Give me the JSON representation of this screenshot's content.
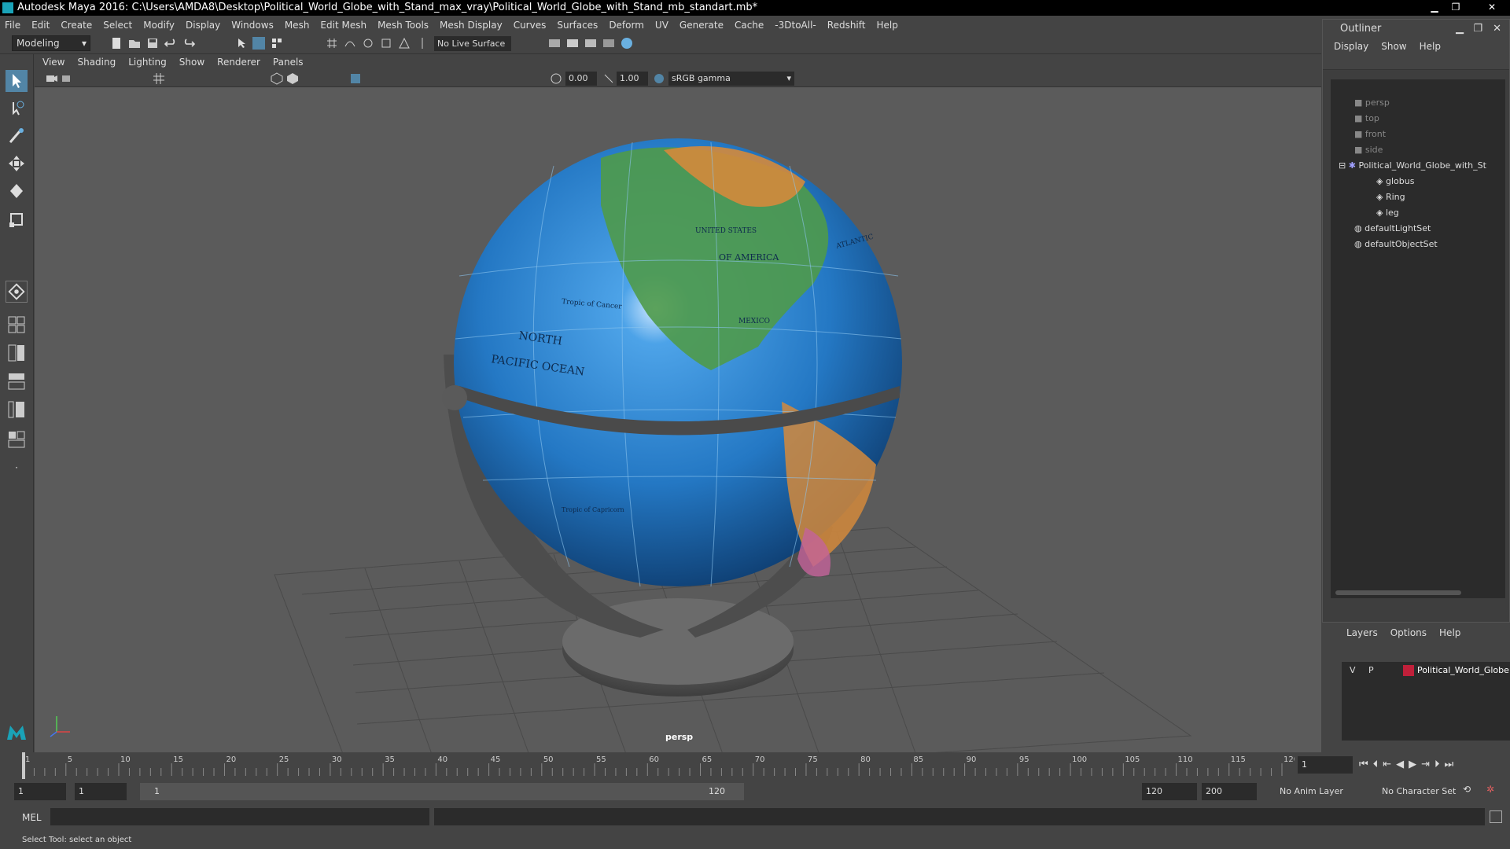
{
  "window": {
    "title": "Autodesk Maya 2016: C:\\Users\\AMDA8\\Desktop\\Political_World_Globe_with_Stand_max_vray\\Political_World_Globe_with_Stand_mb_standart.mb*"
  },
  "menubar": [
    "File",
    "Edit",
    "Create",
    "Select",
    "Modify",
    "Display",
    "Windows",
    "Mesh",
    "Edit Mesh",
    "Mesh Tools",
    "Mesh Display",
    "Curves",
    "Surfaces",
    "Deform",
    "UV",
    "Generate",
    "Cache",
    "-3DtoAll-",
    "Redshift",
    "Help"
  ],
  "toolbar": {
    "mode": "Modeling",
    "live_surface": "No Live Surface"
  },
  "viewport": {
    "menu": [
      "View",
      "Shading",
      "Lighting",
      "Show",
      "Renderer",
      "Panels"
    ],
    "exposure": "0.00",
    "gamma": "1.00",
    "color_space": "sRGB gamma",
    "camera_label": "persp",
    "globe_labels": [
      "UNITED STATES",
      "OF AMERICA",
      "NORTH",
      "PACIFIC OCEAN",
      "Tropic of Cancer",
      "MEXICO",
      "ATLANTIC",
      "Tropic of Capricorn"
    ]
  },
  "outliner": {
    "title": "Outliner",
    "menu": [
      "Display",
      "Show",
      "Help"
    ],
    "items": [
      {
        "label": "persp",
        "type": "camera",
        "dim": true
      },
      {
        "label": "top",
        "type": "camera",
        "dim": true
      },
      {
        "label": "front",
        "type": "camera",
        "dim": true
      },
      {
        "label": "side",
        "type": "camera",
        "dim": true
      },
      {
        "label": "Political_World_Globe_with_St",
        "type": "group",
        "dim": false
      },
      {
        "label": "globus",
        "type": "mesh",
        "dim": false
      },
      {
        "label": "Ring",
        "type": "mesh",
        "dim": false
      },
      {
        "label": "leg",
        "type": "mesh",
        "dim": false
      },
      {
        "label": "defaultLightSet",
        "type": "set",
        "dim": false
      },
      {
        "label": "defaultObjectSet",
        "type": "set",
        "dim": false
      }
    ]
  },
  "layers": {
    "menu": [
      "Layers",
      "Options",
      "Help"
    ],
    "row": {
      "v": "V",
      "p": "P",
      "name": "Political_World_Globe",
      "color": "#c0203a"
    }
  },
  "timeline": {
    "ticks": [
      "1",
      "5",
      "10",
      "15",
      "20",
      "25",
      "30",
      "35",
      "40",
      "45",
      "50",
      "55",
      "60",
      "65",
      "70",
      "75",
      "80",
      "85",
      "90",
      "95",
      "100",
      "105",
      "110",
      "115",
      "120"
    ],
    "current_frame": "1"
  },
  "range": {
    "start": "1",
    "playback_start": "1",
    "slider_start": "1",
    "slider_end": "120",
    "playback_end": "120",
    "end": "200",
    "anim_layer": "No Anim Layer",
    "character_set": "No Character Set"
  },
  "cmdline": {
    "lang": "MEL"
  },
  "helpline": {
    "text": "Select Tool: select an object"
  },
  "colors": {
    "accent": "#1aa3b8",
    "selected_tool": "#5285a6",
    "layer_color": "#c0203a"
  },
  "icons": [
    "select-tool-icon",
    "lasso-tool-icon",
    "paint-select-icon",
    "move-tool-icon",
    "rotate-tool-icon",
    "scale-tool-icon",
    "maya-logo-icon"
  ]
}
